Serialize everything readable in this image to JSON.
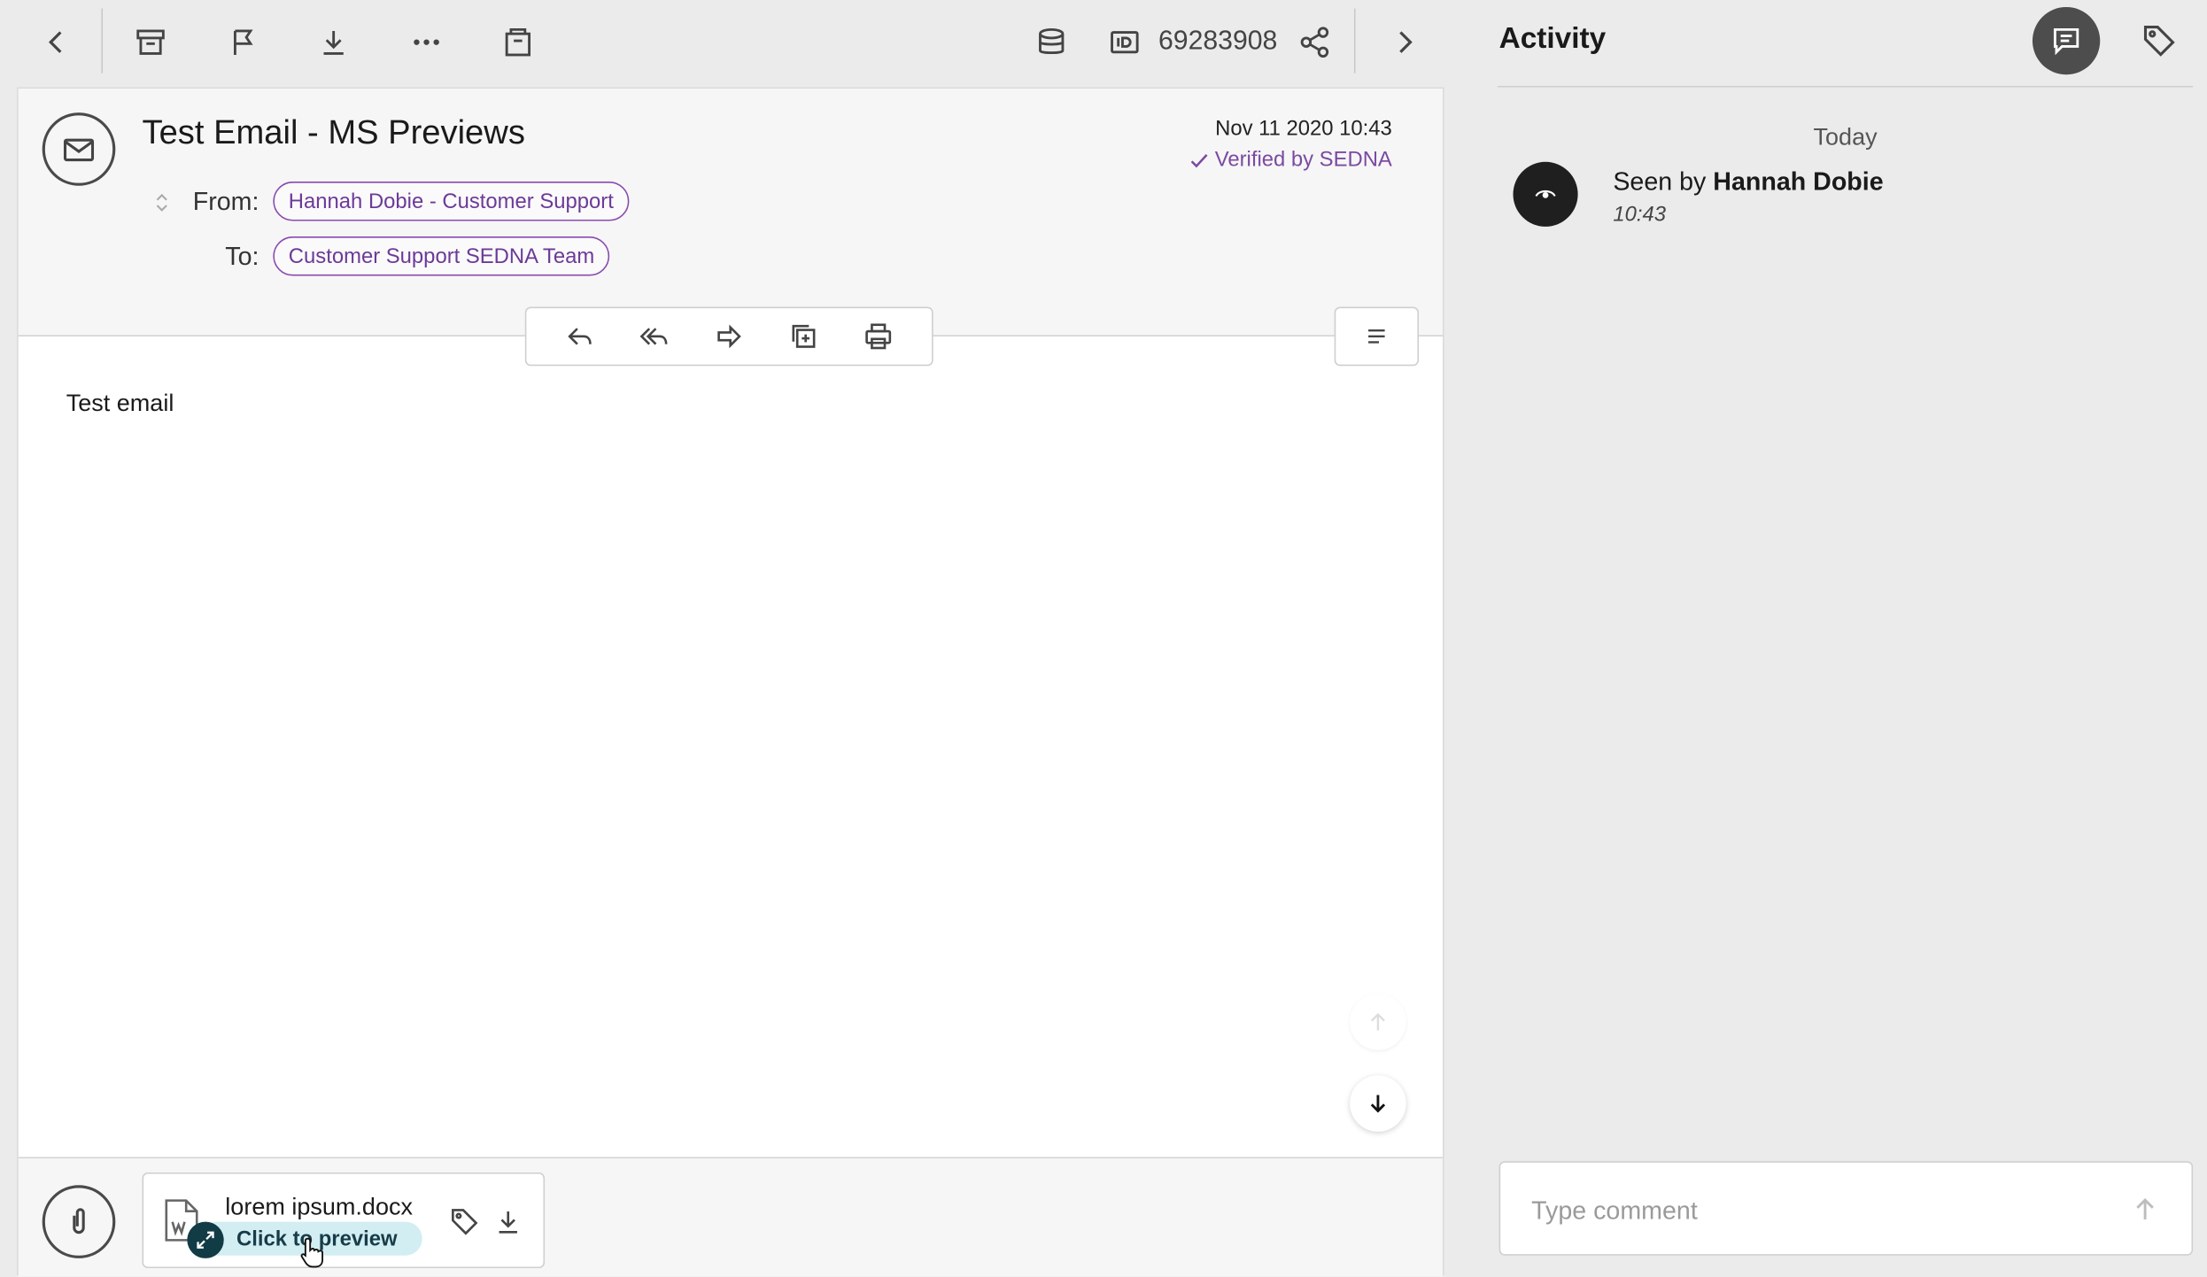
{
  "toolbar": {
    "record_id": "69283908"
  },
  "email": {
    "subject": "Test Email - MS Previews",
    "date": "Nov 11 2020 10:43",
    "verified": "Verified by SEDNA",
    "from_label": "From:",
    "from_value": "Hannah Dobie - Customer Support",
    "to_label": "To:",
    "to_value": "Customer Support SEDNA Team",
    "body": "Test email"
  },
  "attachment": {
    "filename": "lorem ipsum.docx",
    "preview_label": "Click to preview"
  },
  "activity": {
    "title": "Activity",
    "day_header": "Today",
    "seen_prefix": "Seen by",
    "seen_user": "Hannah Dobie",
    "seen_time": "10:43",
    "comment_placeholder": "Type comment"
  },
  "colors": {
    "accent_purple": "#7b4aa2",
    "preview_bg": "#d3eef3",
    "dark_button": "#4d4d4d"
  }
}
